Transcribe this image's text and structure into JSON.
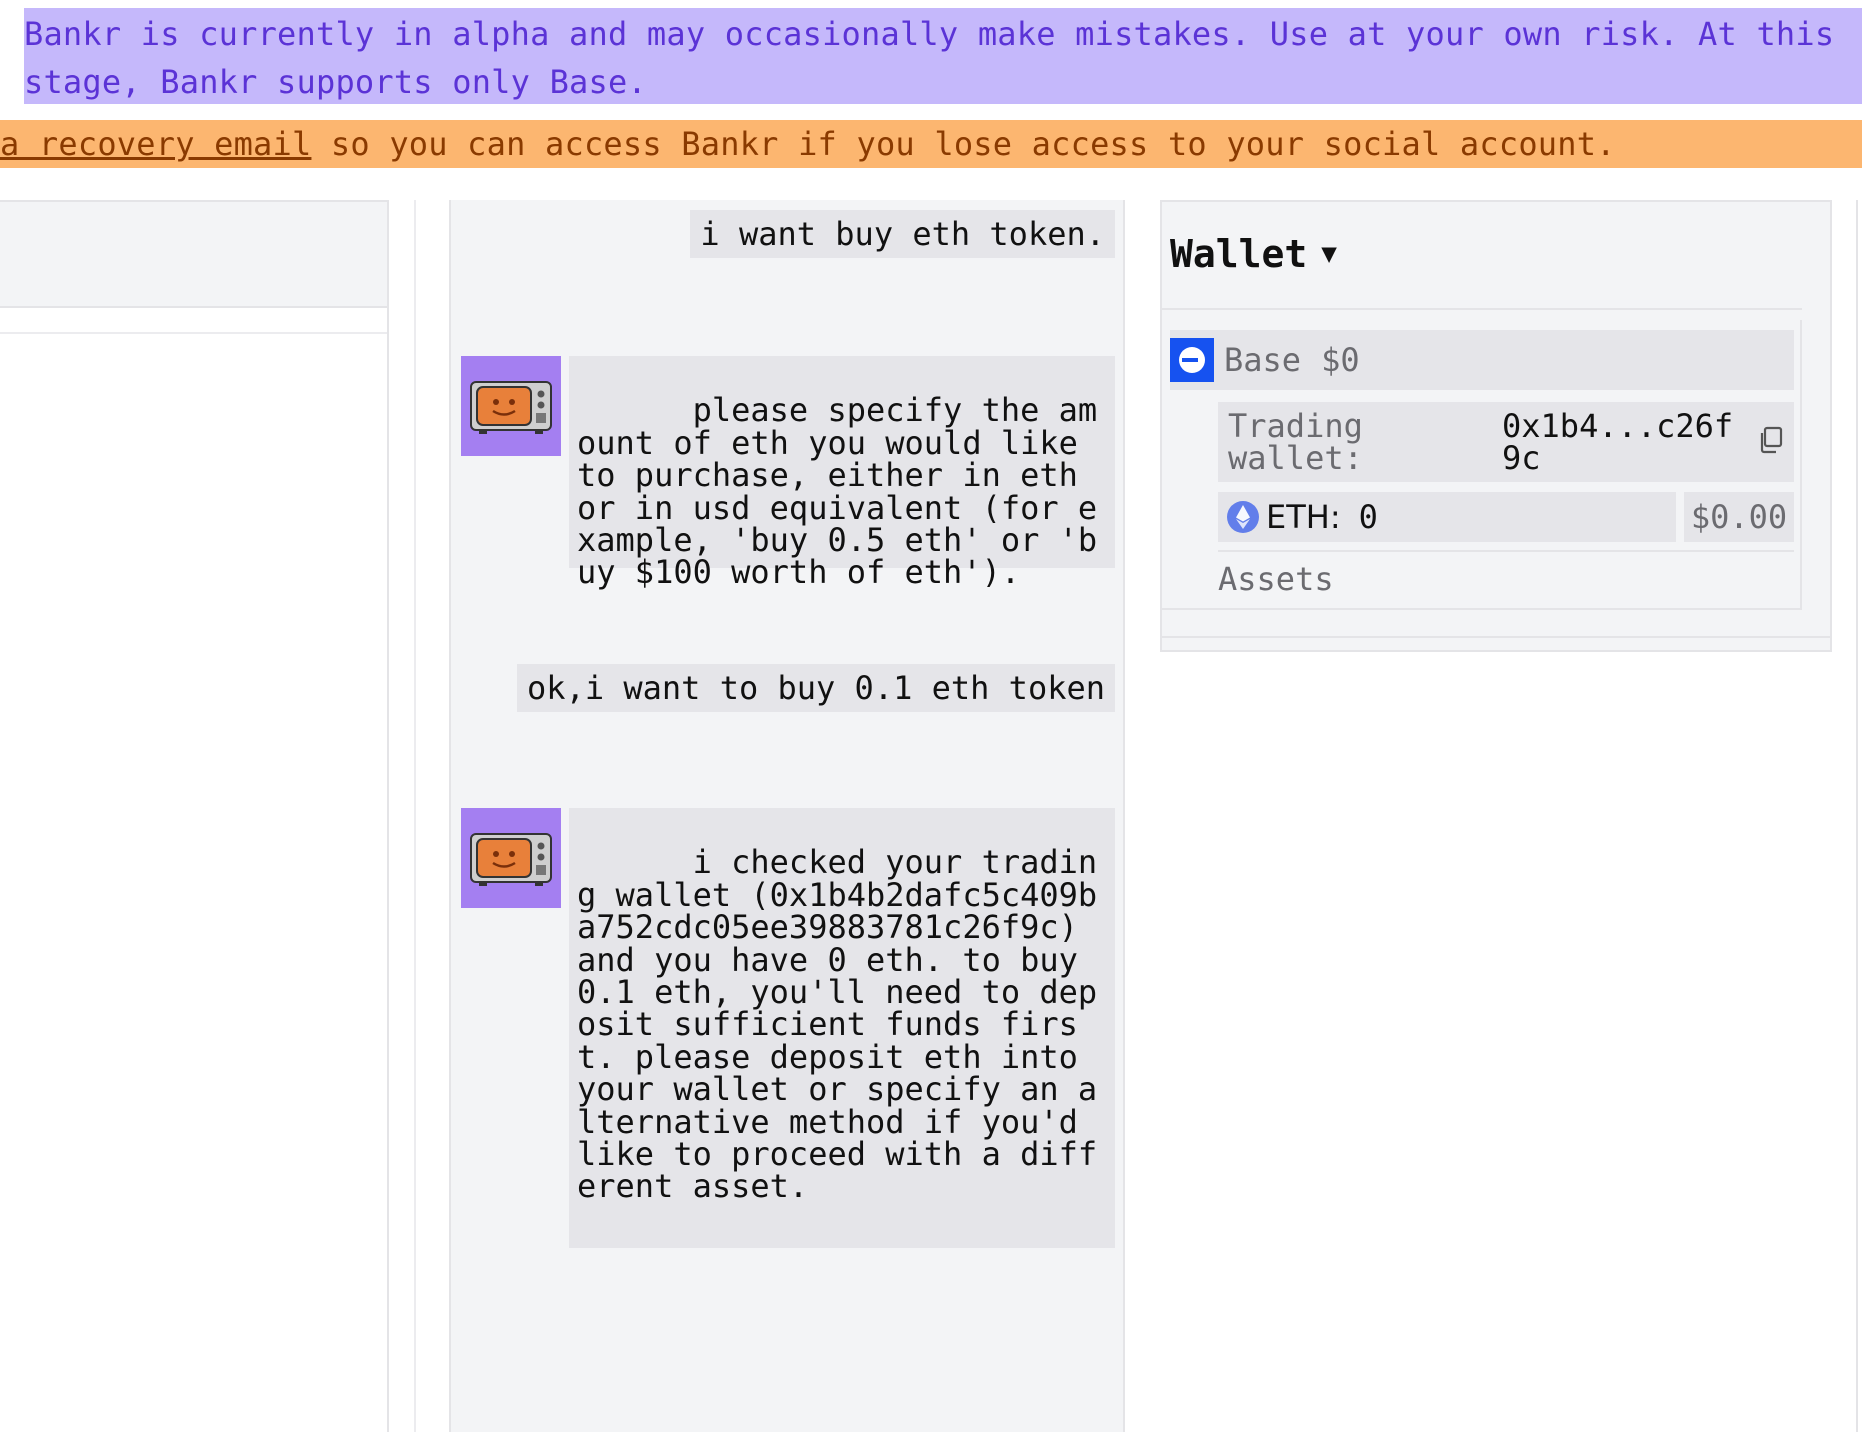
{
  "banners": {
    "alpha_text": "Bankr is currently in alpha and may occasionally make mistakes. Use at your own risk. At this stage, Bankr supports only Base.",
    "recovery_link": "a recovery email",
    "recovery_text": " so you can access Bankr if you lose access to your social account."
  },
  "chat": {
    "messages": [
      {
        "role": "user",
        "text": "i want buy eth token."
      },
      {
        "role": "bot",
        "text": "please specify the amount of eth you would like to purchase, either in eth or in usd equivalent (for example, 'buy 0.5 eth' or 'buy $100 worth of eth')."
      },
      {
        "role": "user",
        "text": "ok,i want to buy 0.1 eth token"
      },
      {
        "role": "bot",
        "text": "i checked your trading wallet (0x1b4b2dafc5c409ba752cdc05ee39883781c26f9c) and you have 0 eth. to buy 0.1 eth, you'll need to deposit sufficient funds first. please deposit eth into your wallet or specify an alternative method if you'd like to proceed with a different asset."
      }
    ]
  },
  "wallet": {
    "title": "Wallet",
    "caret": "▼",
    "network": "Base",
    "network_balance": "$0",
    "trading_label": "Trading\nwallet:",
    "trading_address": "0x1b4...c26f\n9c",
    "eth_label": "ETH:",
    "eth_amount": "0",
    "eth_usd": "$0.00",
    "assets_label": "Assets"
  },
  "colors": {
    "alpha_bg": "#c5b8fb",
    "alpha_text": "#5b33d6",
    "recovery_bg": "#fcb670",
    "avatar_bg": "#a47ff1",
    "base_blue": "#1652f0",
    "eth_purple": "#627eea"
  }
}
